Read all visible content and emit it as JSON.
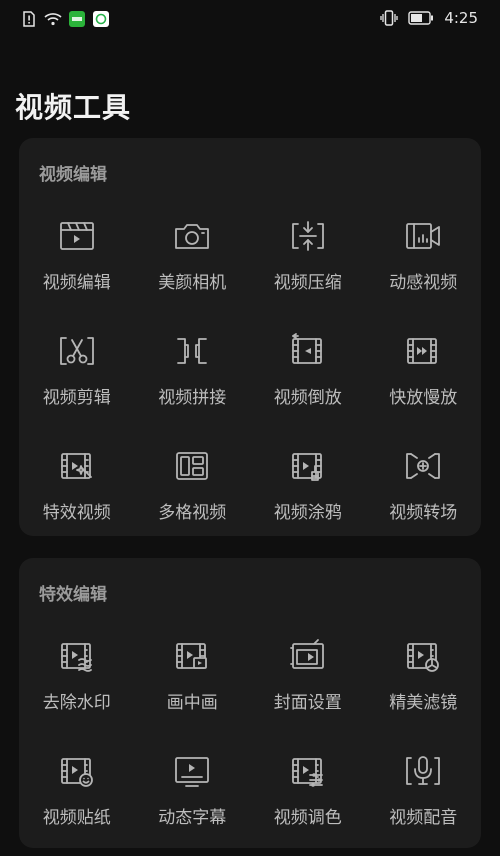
{
  "status_bar": {
    "time": "4:25",
    "left_icons": [
      "sim-alert-icon",
      "wifi-icon",
      "app-badge-icon",
      "chat-app-icon"
    ],
    "right_icons": [
      "vibrate-icon",
      "battery-icon"
    ]
  },
  "page_title": "视频工具",
  "sections": [
    {
      "title": "视频编辑",
      "rows": [
        [
          {
            "label": "视频编辑",
            "icon": "clapperboard-icon"
          },
          {
            "label": "美颜相机",
            "icon": "camera-icon"
          },
          {
            "label": "视频压缩",
            "icon": "compress-icon"
          },
          {
            "label": "动感视频",
            "icon": "video-camera-icon"
          }
        ],
        [
          {
            "label": "视频剪辑",
            "icon": "scissors-icon"
          },
          {
            "label": "视频拼接",
            "icon": "join-icon"
          },
          {
            "label": "视频倒放",
            "icon": "reverse-icon"
          },
          {
            "label": "快放慢放",
            "icon": "fast-forward-icon"
          }
        ],
        [
          {
            "label": "特效视频",
            "icon": "effect-wand-icon"
          },
          {
            "label": "多格视频",
            "icon": "multi-grid-icon"
          },
          {
            "label": "视频涂鸦",
            "icon": "brush-icon"
          },
          {
            "label": "视频转场",
            "icon": "transition-icon"
          }
        ]
      ]
    },
    {
      "title": "特效编辑",
      "rows": [
        [
          {
            "label": "去除水印",
            "icon": "remove-watermark-icon"
          },
          {
            "label": "画中画",
            "icon": "picture-in-picture-icon"
          },
          {
            "label": "封面设置",
            "icon": "cover-icon"
          },
          {
            "label": "精美滤镜",
            "icon": "filter-icon"
          }
        ],
        [
          {
            "label": "视频贴纸",
            "icon": "sticker-icon"
          },
          {
            "label": "动态字幕",
            "icon": "subtitle-icon"
          },
          {
            "label": "视频调色",
            "icon": "color-adjust-icon"
          },
          {
            "label": "视频配音",
            "icon": "microphone-icon"
          }
        ]
      ]
    }
  ]
}
